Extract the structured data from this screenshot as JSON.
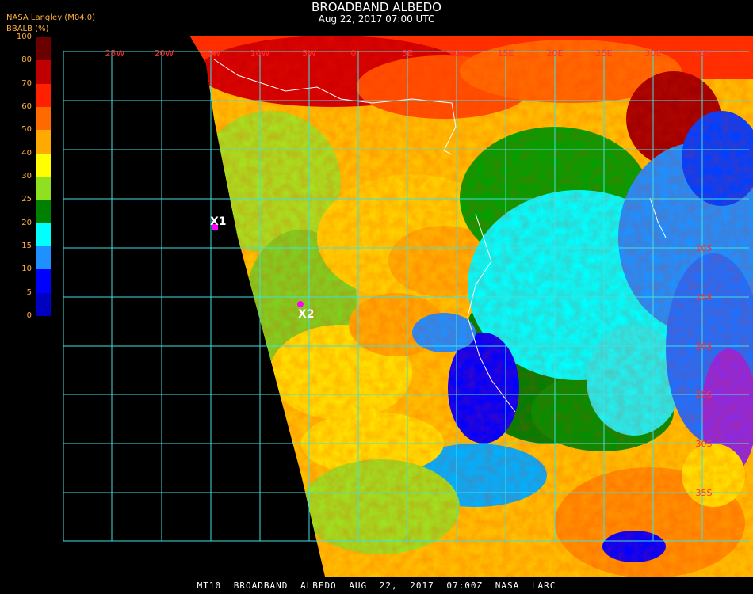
{
  "header": {
    "title": "BROADBAND ALBEDO",
    "subtitle": "Aug 22, 2017 07:00 UTC",
    "source": "NASA Langley (M04.0)",
    "scale_label": "BBALB (%)"
  },
  "colorbar": {
    "ticks": [
      "100",
      "80",
      "70",
      "60",
      "50",
      "40",
      "30",
      "25",
      "20",
      "15",
      "10",
      "5",
      "0"
    ],
    "colors": [
      "#6b0000",
      "#c00000",
      "#ff2000",
      "#ff6a00",
      "#ffaa00",
      "#ffff00",
      "#90e020",
      "#008000",
      "#00ffff",
      "#1e90ff",
      "#0000ff",
      "#0000c0",
      "#8a2be2"
    ]
  },
  "map": {
    "lon_labels": [
      "25W",
      "20W",
      "15W",
      "10W",
      "5W",
      "0",
      "5E",
      "10E",
      "15E",
      "20E",
      "25E",
      "30E",
      "35E"
    ],
    "lat_labels": [
      "10S",
      "15S",
      "20S",
      "25S",
      "30S",
      "35S"
    ],
    "sites": [
      {
        "name": "X1"
      },
      {
        "name": "X2"
      }
    ],
    "grid_color": "#40e0e0",
    "site_color": "#ff00ff"
  },
  "footer": {
    "text": "MT10 BROADBAND ALBEDO AUG 22, 2017 07:00Z NASA LARC"
  }
}
